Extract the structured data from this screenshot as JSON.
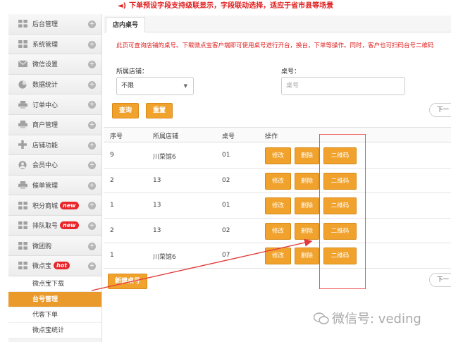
{
  "banner": "下单预设字段支持级联显示，字段联动选择，适应于省市县等场景",
  "sidebar": {
    "items": [
      {
        "label": "后台管理",
        "icon": "grid-icon",
        "badge": ""
      },
      {
        "label": "系统管理",
        "icon": "grid-icon",
        "badge": ""
      },
      {
        "label": "微信设置",
        "icon": "mail-icon",
        "badge": ""
      },
      {
        "label": "数据统计",
        "icon": "chart-icon",
        "badge": ""
      },
      {
        "label": "订单中心",
        "icon": "printer-icon",
        "badge": ""
      },
      {
        "label": "商户管理",
        "icon": "printer-icon",
        "badge": ""
      },
      {
        "label": "店铺功能",
        "icon": "plus-icon",
        "badge": ""
      },
      {
        "label": "会员中心",
        "icon": "user-icon",
        "badge": ""
      },
      {
        "label": "催单管理",
        "icon": "printer-icon",
        "badge": ""
      },
      {
        "label": "积分商城",
        "icon": "grid-icon",
        "badge": "new"
      },
      {
        "label": "排队取号",
        "icon": "grid-icon",
        "badge": "new"
      },
      {
        "label": "微团购",
        "icon": "grid-icon",
        "badge": ""
      },
      {
        "label": "微点宝",
        "icon": "grid-icon",
        "badge": "hot"
      }
    ],
    "sub_items": [
      {
        "label": "微点宝下载"
      },
      {
        "label": "台号管理"
      },
      {
        "label": "代客下单"
      },
      {
        "label": "微点宝统计"
      }
    ]
  },
  "tab": "店内桌号",
  "description": "此页可查询店铺的桌号。下载微点宝客户端即可使用桌号进行开台，换台，下单等操作。同时，客户也可扫码台号二维码",
  "filters": {
    "store_label": "所属店铺：",
    "store_value": "不限",
    "table_label": "桌号：",
    "table_placeholder": "桌号"
  },
  "buttons": {
    "query": "查询",
    "reset": "重置",
    "next": "下一",
    "add": "新建桌号"
  },
  "table": {
    "headers": [
      "序号",
      "所属店铺",
      "桌号",
      "操作"
    ],
    "action_labels": {
      "edit": "修改",
      "delete": "删除",
      "qr": "二维码"
    },
    "rows": [
      {
        "id": "9",
        "store": "川菜馆6",
        "table_no": "01"
      },
      {
        "id": "2",
        "store": "13",
        "table_no": "02"
      },
      {
        "id": "1",
        "store": "13",
        "table_no": "01"
      },
      {
        "id": "2",
        "store": "13",
        "table_no": "02"
      },
      {
        "id": "1",
        "store": "川菜馆6",
        "table_no": "07"
      }
    ]
  },
  "watermark": "微信号: veding",
  "colors": {
    "accent": "#f0a22c",
    "alert": "#e02020",
    "badge": "#e8262a"
  }
}
